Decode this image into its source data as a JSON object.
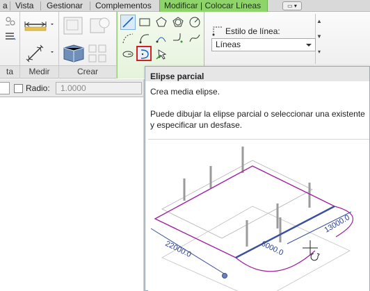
{
  "tabs": {
    "items": [
      {
        "label": "a"
      },
      {
        "label": "Vista"
      },
      {
        "label": "Gestionar"
      },
      {
        "label": "Complementos"
      },
      {
        "label": "Modificar | Colocar Líneas"
      }
    ],
    "extra_icon": "window-menu-icon"
  },
  "ribbon": {
    "panels": [
      {
        "label": "ta"
      },
      {
        "label": "Medir"
      },
      {
        "label": "Crear"
      }
    ],
    "line_style": {
      "label": "Estilo de línea:",
      "value": "Líneas"
    }
  },
  "options_bar": {
    "radius_label": "Radio:",
    "radius_value": "1.0000"
  },
  "tooltip": {
    "title": "Elipse parcial",
    "subtitle": "Crea media elipse.",
    "description": "Puede dibujar la elipse parcial o seleccionar una existente y especificar un desfase.",
    "dims": {
      "left": "22000.0",
      "middle": "6000.0",
      "right": "13000.0"
    }
  },
  "colors": {
    "active_tab": "#8fd46a",
    "highlight_border": "#d22020",
    "sketch_line": "#a020a0",
    "dimension_line": "#3a4fa0"
  }
}
